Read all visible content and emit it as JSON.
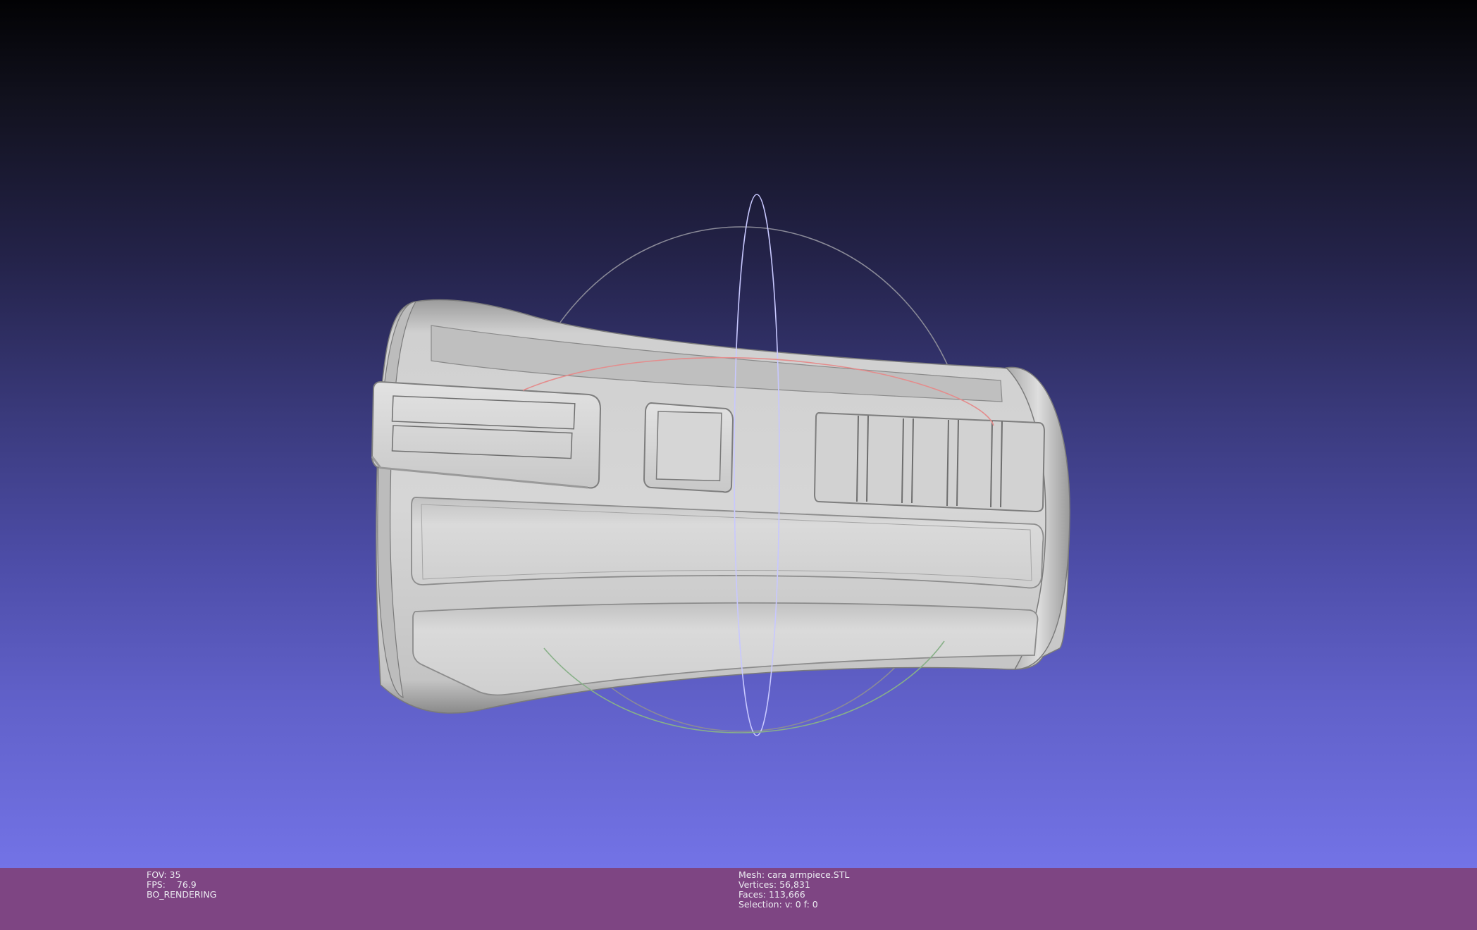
{
  "viewport": {
    "mesh_name": "cara armpiece.STL",
    "trackball": {
      "x_axis_color": "#e88a8a",
      "y_axis_color": "#c8c8ff",
      "z_axis_color": "#8ab88a",
      "outline_color": "#9a9aa6"
    },
    "mesh_color": "#d4d4d4",
    "background_gradient": [
      "#000000",
      "#7474e8"
    ]
  },
  "info_left": {
    "fov_label": "FOV:",
    "fov_value": "35",
    "fps_label": "FPS:",
    "fps_value": "76.9",
    "render_mode": "BO_RENDERING"
  },
  "info_center": {
    "mesh_label": "Mesh:",
    "mesh_value": "cara armpiece.STL",
    "vertices_label": "Vertices:",
    "vertices_value": "56,831",
    "faces_label": "Faces:",
    "faces_value": "113,666",
    "selection_label": "Selection:",
    "selection_value": "v: 0 f: 0"
  },
  "colors": {
    "info_bar_bg": "#7e4583",
    "info_text": "#ececf2"
  }
}
